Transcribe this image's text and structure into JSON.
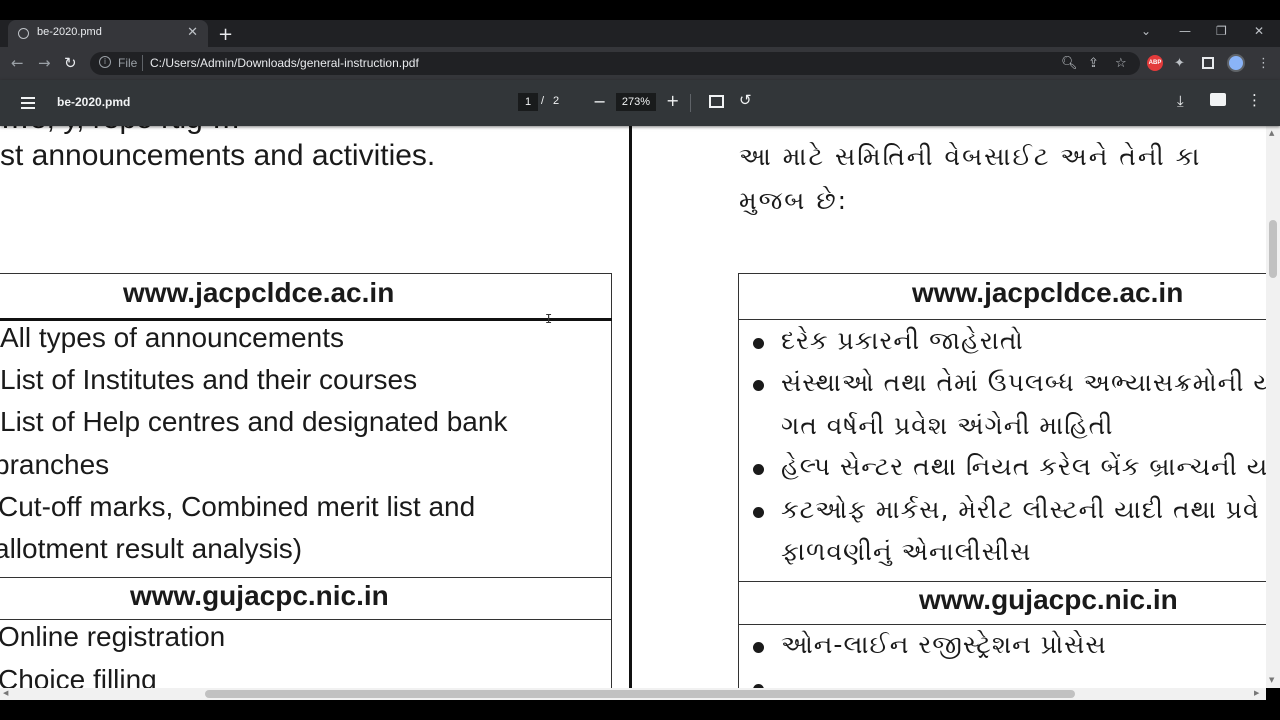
{
  "browser": {
    "tab_title": "be-2020.pmd",
    "tab_close": "✕",
    "new_tab": "+",
    "window_minimize": "—",
    "window_maximize": "❐",
    "window_close": "✕",
    "tab_search": "⌄",
    "nav_back": "←",
    "nav_forward": "→",
    "nav_reload": "↻",
    "scheme_label": "File",
    "url": "C:/Users/Admin/Downloads/general-instruction.pdf",
    "extensions": [
      "zoom-icon",
      "share-icon",
      "star-icon",
      "abp-icon",
      "puzzle-icon",
      "sidepanel-icon",
      "profile-avatar"
    ],
    "abp_label": "ABP"
  },
  "pdf_toolbar": {
    "title": "be-2020.pmd",
    "current_page": "1",
    "page_separator": "/",
    "total_pages": "2",
    "zoom": "273%",
    "zoom_out": "−",
    "zoom_in": "+"
  },
  "document": {
    "left_intro": "st announcements and activities.",
    "left_table": {
      "site1": "www.jacpcldce.ac.in",
      "items1": [
        "All types of announcements",
        "List of Institutes and their courses",
        "List of Help centres and designated bank",
        "branches",
        "Cut-off marks, Combined merit list and",
        "allotment result analysis)"
      ],
      "site2": "www.gujacpc.nic.in",
      "items2": [
        "Online registration",
        "Choice filling"
      ]
    },
    "right_intro": [
      "આ માટે સમિતિની વેબસાઈટ અને તેની કા",
      "મુજબ છે:"
    ],
    "right_table": {
      "site1": "www.jacpcldce.ac.in",
      "items1": [
        "દરેક પ્રકારની જાહેરાતો",
        "સંસ્થાઓ તથા તેમાં ઉપલબ્ધ અભ્યાસક્રમોની ય",
        "ગત વર્ષની પ્રવેશ અંગેની માહિતી",
        "હેલ્પ સેન્ટર તથા નિયત કરેલ બેંક બ્રાન્ચની યા",
        "કટઓફ માર્કસ, મેરીટ લીસ્ટની યાદી તથા પ્રવે",
        "ફાળવણીનું એનાલીસીસ"
      ],
      "site2": "www.gujacpc.nic.in",
      "items2": [
        "ઓન-લાઈન રજીસ્ટ્રેશન પ્રોસેસ"
      ]
    }
  },
  "colors": {
    "tab_bg": "#35363a",
    "strip_bg": "#202124",
    "pdf_toolbar_bg": "#323639",
    "abp_red": "#e33b3b"
  }
}
